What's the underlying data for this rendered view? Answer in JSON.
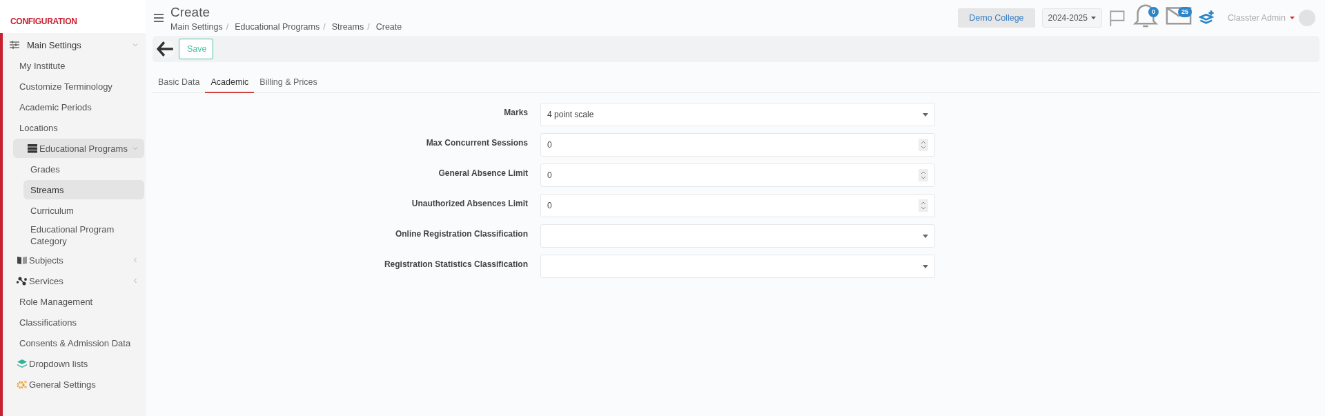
{
  "sidebar": {
    "heading": "CONFIGURATION",
    "items": [
      {
        "label": "Main Settings",
        "expanded": true,
        "children": [
          {
            "label": "My Institute",
            "selected": false
          },
          {
            "label": "Customize Terminology",
            "selected": false
          },
          {
            "label": "Academic Periods",
            "selected": false
          },
          {
            "label": "Locations",
            "selected": false
          },
          {
            "label": "Educational Programs",
            "expanded": true,
            "children": [
              {
                "label": "Grades",
                "selected": false
              },
              {
                "label": "Streams",
                "selected": true
              },
              {
                "label": "Curriculum",
                "selected": false
              },
              {
                "label": "Educational Program Category",
                "selected": false
              }
            ]
          },
          {
            "label": "Subjects",
            "expanded": false
          },
          {
            "label": "Services",
            "expanded": false
          },
          {
            "label": "Role Management",
            "selected": false
          },
          {
            "label": "Classifications",
            "selected": false
          },
          {
            "label": "Consents & Admission Data",
            "selected": false
          },
          {
            "label": "Dropdown lists",
            "selected": false
          },
          {
            "label": "General Settings",
            "selected": false
          }
        ]
      }
    ]
  },
  "header": {
    "title": "Create",
    "breadcrumbs": [
      "Main Settings",
      "Educational Programs",
      "Streams",
      "Create"
    ],
    "breadcrumb_separator": "/",
    "college": "Demo College",
    "year": "2024-2025",
    "notifications": "0",
    "messages": "25",
    "user": "Classter Admin"
  },
  "toolbar": {
    "save": "Save"
  },
  "tabs": [
    {
      "label": "Basic Data",
      "selected": false
    },
    {
      "label": "Academic",
      "selected": true
    },
    {
      "label": "Billing & Prices",
      "selected": false
    }
  ],
  "form": [
    {
      "label": "Marks",
      "kind": "select",
      "value": "4 point scale"
    },
    {
      "label": "Max Concurrent Sessions",
      "kind": "number",
      "value": "0"
    },
    {
      "label": "General Absence Limit",
      "kind": "number",
      "value": "0"
    },
    {
      "label": "Unauthorized Absences Limit",
      "kind": "number",
      "value": "0"
    },
    {
      "label": "Online Registration Classification",
      "kind": "select"
    },
    {
      "label": "Registration Statistics Classification",
      "kind": "select"
    }
  ]
}
